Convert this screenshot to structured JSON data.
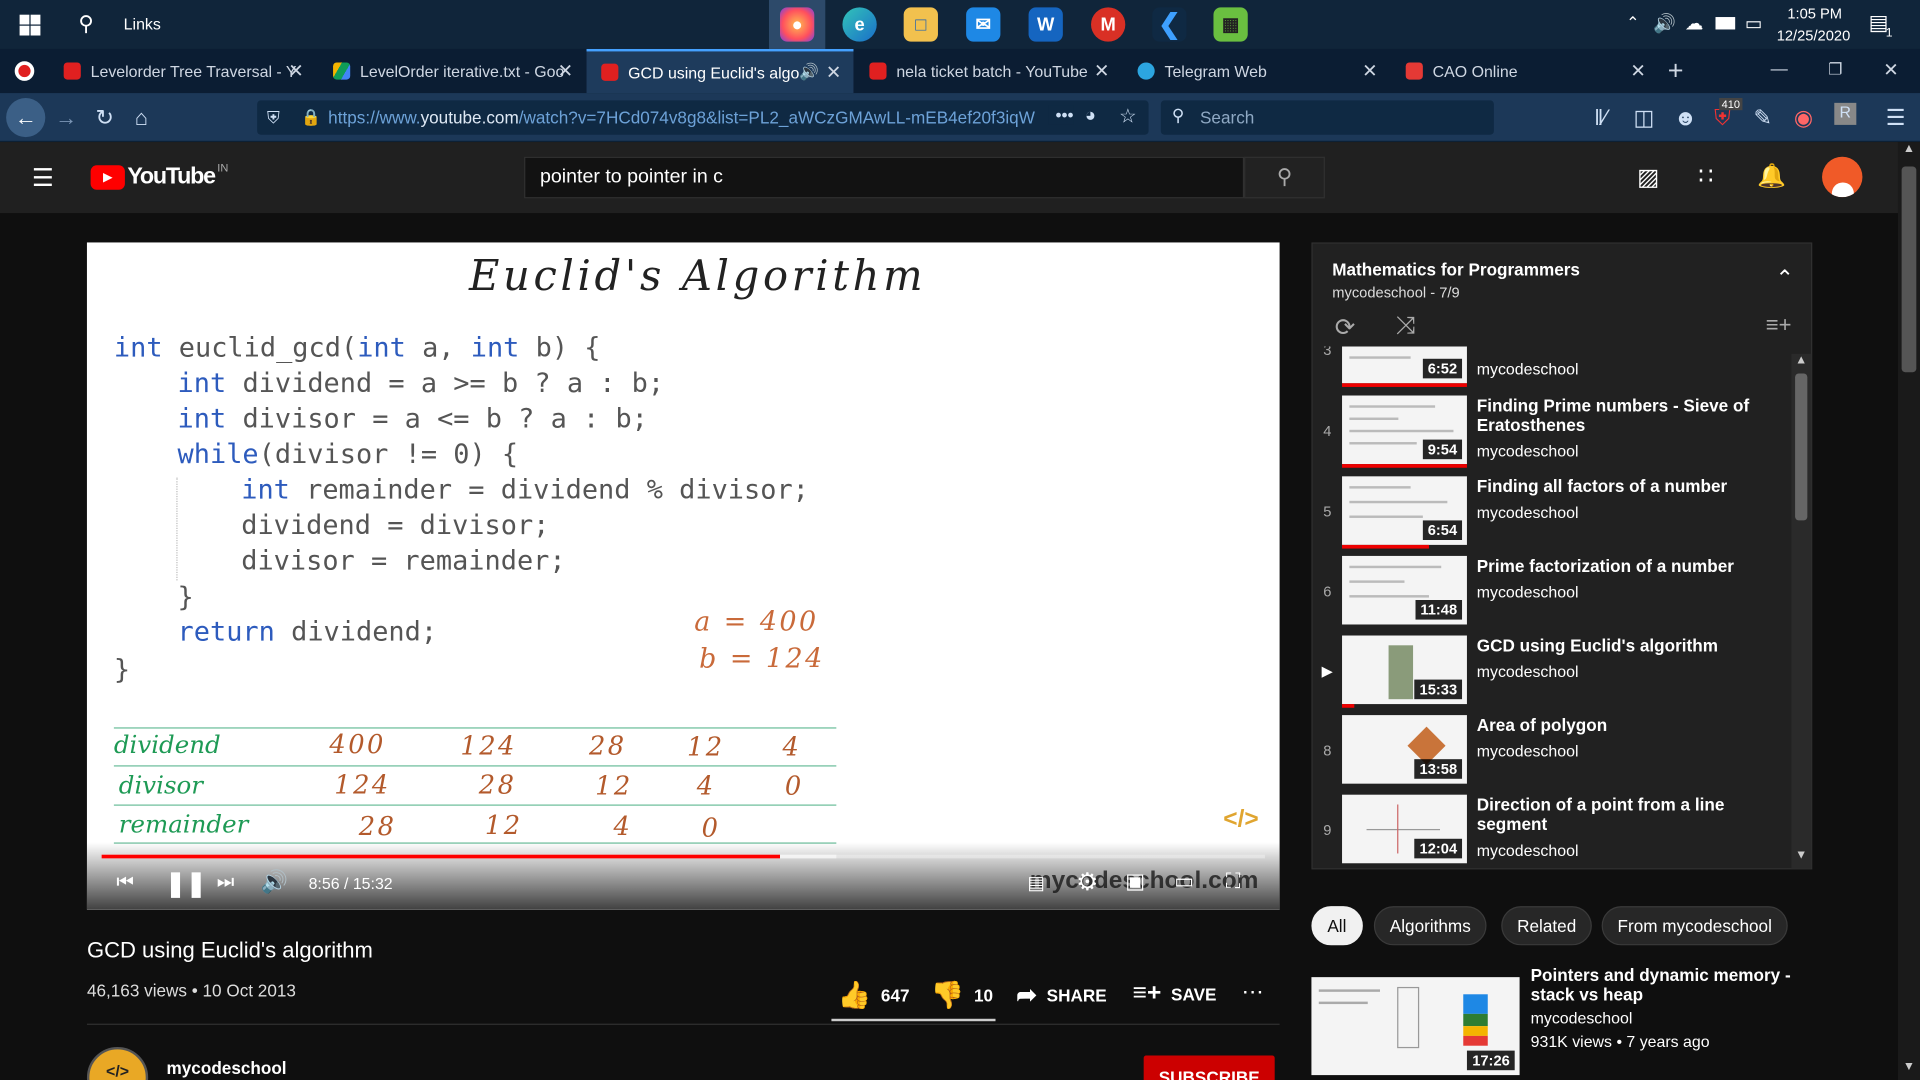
{
  "taskbar": {
    "search_label": "Links",
    "time": "1:05 PM",
    "date": "12/25/2020",
    "notif_count": "1"
  },
  "tabs": [
    {
      "title": "Levelorder Tree Traversal - Y",
      "color": "#e02020"
    },
    {
      "title": "LevelOrder iterative.txt - Goo",
      "color": "#f4b400"
    },
    {
      "title": "GCD using Euclid's algorit",
      "color": "#e02020"
    },
    {
      "title": "nela ticket batch - YouTube",
      "color": "#e02020"
    },
    {
      "title": "Telegram Web",
      "color": "#2ca5e0"
    },
    {
      "title": "CAO Online",
      "color": "#e53935"
    }
  ],
  "nav": {
    "url_prefix": "https://www.",
    "url_host": "youtube.com",
    "url_rest": "/watch?v=7HCd074v8g8&list=PL2_aWCzGMAwLL-mEB4ef20f3iqW",
    "search_placeholder": "Search",
    "badge": "410"
  },
  "yt": {
    "logo_text": "YouTube",
    "region": "IN",
    "search_value": "pointer to pointer in c"
  },
  "video": {
    "slide_title": "Euclid's Algorithm",
    "code": {
      "l1a": "int",
      "l1b": " euclid_gcd(",
      "l1c": "int",
      "l1d": " a, ",
      "l1e": "int",
      "l1f": " b) {",
      "l2a": "int",
      "l2b": " dividend = a >= b ? a : b;",
      "l3a": "int",
      "l3b": " divisor = a <= b ? a : b;",
      "l4a": "while",
      "l4b": "(divisor != 0) {",
      "l5a": "int",
      "l5b": " remainder = dividend % divisor;",
      "l6": "dividend = divisor;",
      "l7": "divisor = remainder;",
      "l8": "}",
      "l9a": "return",
      "l9b": " dividend;",
      "l10": "}"
    },
    "note_a": "a = 400",
    "note_b": "b = 124",
    "table": {
      "dividend_label": "dividend",
      "divisor_label": "divisor",
      "remainder_label": "remainder",
      "dividend": [
        "400",
        "124",
        "28",
        "12",
        "4"
      ],
      "divisor": [
        "124",
        "28",
        "12",
        "4",
        "0"
      ],
      "remainder": [
        "28",
        "12",
        "4",
        "0"
      ]
    },
    "time_display": "8:56 / 15:32",
    "watermark": "mycodeschool.com",
    "progress": 0.583,
    "title": "GCD using Euclid's algorithm",
    "meta": "46,163 views • 10 Oct 2013",
    "likes": "647",
    "dislikes": "10",
    "share_label": "SHARE",
    "save_label": "SAVE",
    "channel": "mycodeschool",
    "subscribe_label": "SUBSCRIBE"
  },
  "playlist": {
    "title": "Mathematics for Programmers",
    "sub": "mycodeschool - 7/9",
    "items": [
      {
        "num": "3",
        "title": "",
        "channel": "mycodeschool",
        "duration": "6:52",
        "progress": 1.0
      },
      {
        "num": "4",
        "title": "Finding Prime numbers - Sieve of Eratosthenes",
        "channel": "mycodeschool",
        "duration": "9:54",
        "progress": 1.0
      },
      {
        "num": "5",
        "title": "Finding all factors of a number",
        "channel": "mycodeschool",
        "duration": "6:54",
        "progress": 0.7
      },
      {
        "num": "6",
        "title": "Prime factorization of a number",
        "channel": "mycodeschool",
        "duration": "11:48",
        "progress": 0.0
      },
      {
        "num": "▶",
        "title": "GCD using Euclid's algorithm",
        "channel": "mycodeschool",
        "duration": "15:33",
        "progress": 0.1
      },
      {
        "num": "8",
        "title": "Area of polygon",
        "channel": "mycodeschool",
        "duration": "13:58",
        "progress": 0.0
      },
      {
        "num": "9",
        "title": "Direction of a point from a line segment",
        "channel": "mycodeschool",
        "duration": "12:04",
        "progress": 0.0
      }
    ]
  },
  "chips": [
    "All",
    "Algorithms",
    "Related",
    "From mycodeschool"
  ],
  "recommended": {
    "title": "Pointers and dynamic memory - stack vs heap",
    "channel": "mycodeschool",
    "meta": "931K views • 7 years ago",
    "duration": "17:26"
  }
}
